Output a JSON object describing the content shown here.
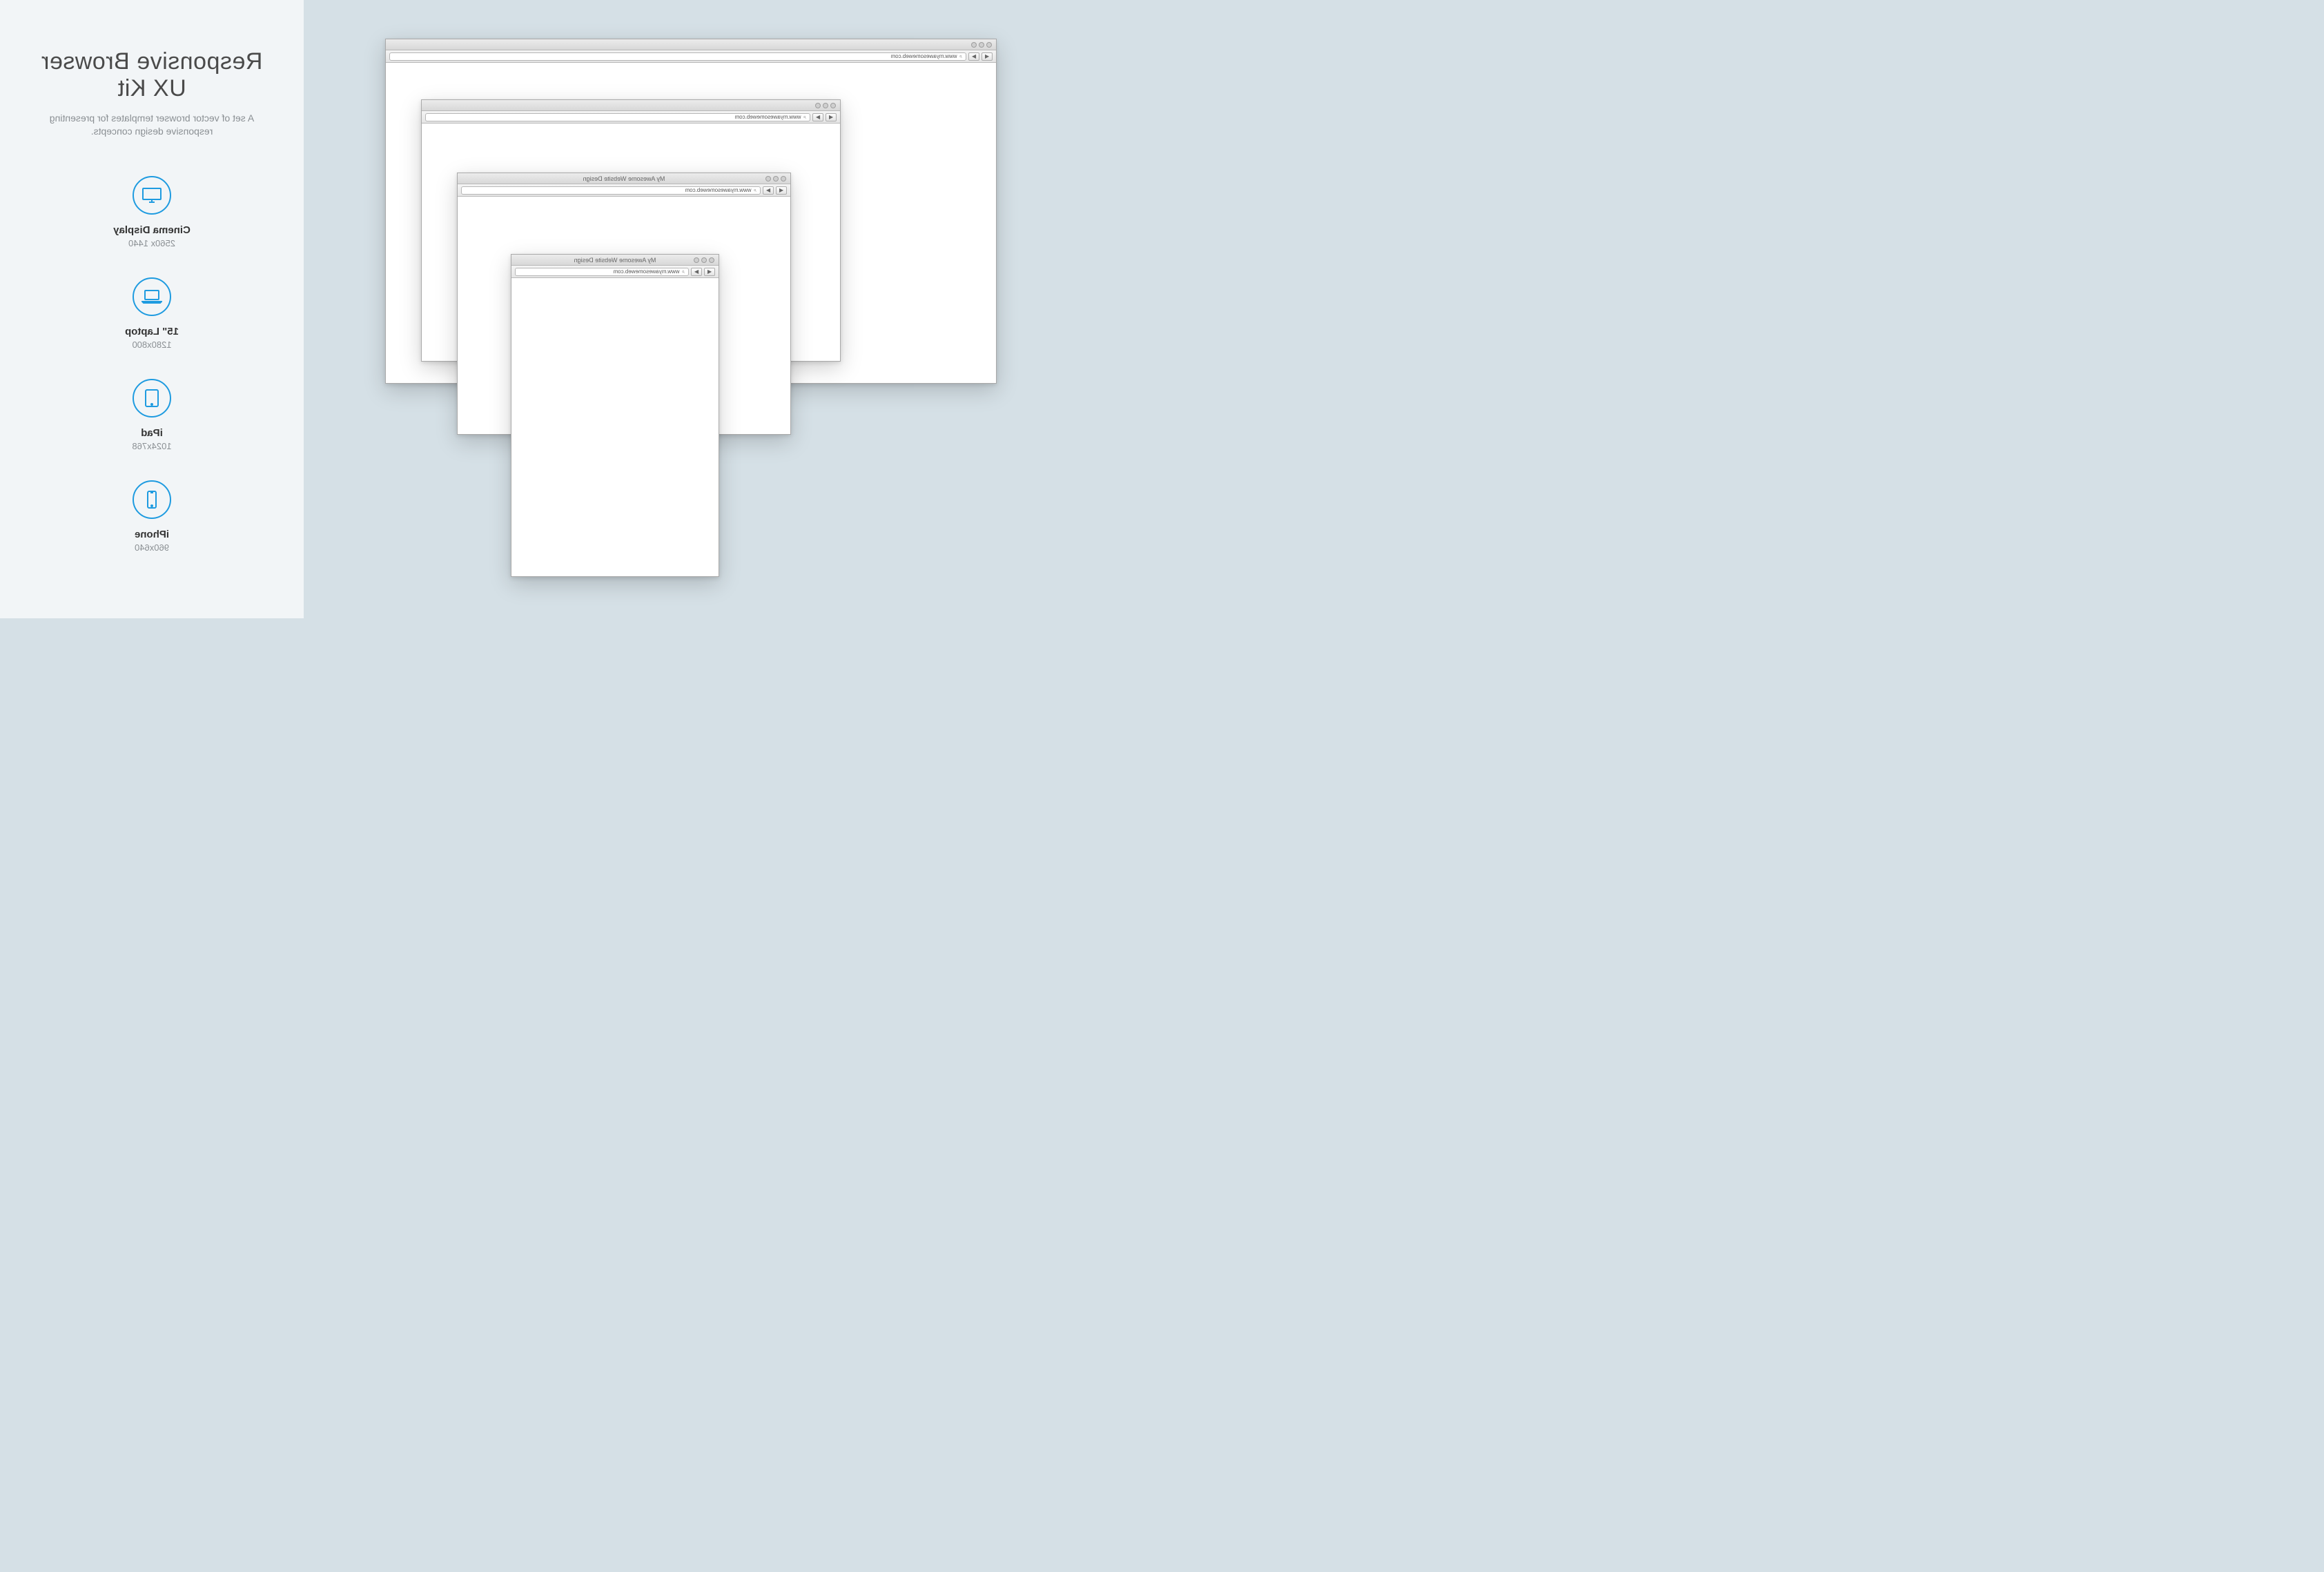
{
  "panel": {
    "title": "Responsive Browser UX Kit",
    "subtitle": "A set of vector browser templates for presenting responsive design concepts."
  },
  "devices": [
    {
      "name": "Cinema Display",
      "resolution": "2560x 1440",
      "icon": "monitor-icon"
    },
    {
      "name": "15\" Laptop",
      "resolution": "1280x800",
      "icon": "laptop-icon"
    },
    {
      "name": "iPad",
      "resolution": "1024x768",
      "icon": "tablet-icon"
    },
    {
      "name": "iPhone",
      "resolution": "960x640",
      "icon": "phone-icon"
    }
  ],
  "browsers": [
    {
      "window_title": "",
      "url": "www.myawesomeweb.com"
    },
    {
      "window_title": "",
      "url": "www.myawesomeweb.com"
    },
    {
      "window_title": "My Awesome Website Design",
      "url": "www.myawesomeweb.com"
    },
    {
      "window_title": "My Awesome Website Design",
      "url": "www.myawesomeweb.com"
    }
  ],
  "colors": {
    "accent": "#1e9be0"
  }
}
